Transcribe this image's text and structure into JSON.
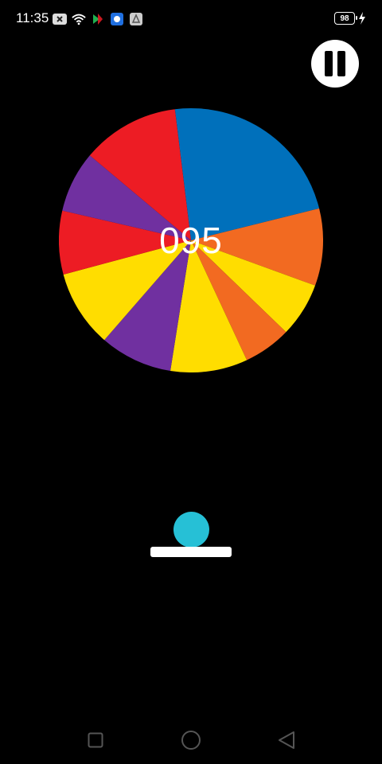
{
  "status_bar": {
    "time": "11:35",
    "battery_level": "98",
    "icons": [
      "notification-x-icon",
      "wifi-icon",
      "app-icon-1",
      "app-icon-2",
      "app-icon-3",
      "charging-bolt-icon"
    ]
  },
  "game": {
    "score": "095",
    "ball_color": "#26c0d6",
    "paddle_color": "#ffffff",
    "wheel_segments": [
      {
        "color": "#0070bb"
      },
      {
        "color": "#f26a21"
      },
      {
        "color": "#ffdd00"
      },
      {
        "color": "#f26a21"
      },
      {
        "color": "#ffdd00"
      },
      {
        "color": "#7030a0"
      },
      {
        "color": "#ffdd00"
      },
      {
        "color": "#ed1c24"
      },
      {
        "color": "#7030a0"
      },
      {
        "color": "#ed1c24"
      }
    ]
  },
  "controls": {
    "pause_icon": "pause-icon"
  },
  "navigation": {
    "recents_icon": "square-icon",
    "home_icon": "circle-icon",
    "back_icon": "triangle-back-icon"
  }
}
